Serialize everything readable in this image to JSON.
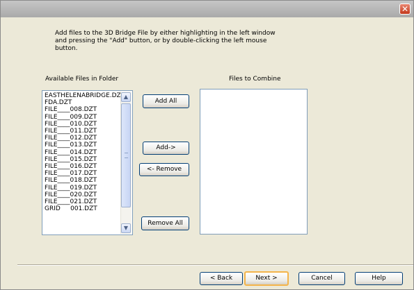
{
  "window": {
    "title": "",
    "close_glyph": "✕"
  },
  "instructions": "Add files to the 3D Bridge File by either highlighting in the left window and pressing the \"Add\" button, or by double-clicking the left mouse button.",
  "available": {
    "label": "Available Files in Folder",
    "files": [
      "EASTHELENABRIDGE.DZT",
      "FDA.DZT",
      "FILE____008.DZT",
      "FILE____009.DZT",
      "FILE____010.DZT",
      "FILE____011.DZT",
      "FILE____012.DZT",
      "FILE____013.DZT",
      "FILE____014.DZT",
      "FILE____015.DZT",
      "FILE____016.DZT",
      "FILE____017.DZT",
      "FILE____018.DZT",
      "FILE____019.DZT",
      "FILE____020.DZT",
      "FILE____021.DZT",
      "GRID     001.DZT"
    ],
    "scroll_up": "▲",
    "scroll_down": "▼"
  },
  "combine": {
    "label": "Files to Combine",
    "files": []
  },
  "actions": {
    "add_all": "Add All",
    "add": "Add->",
    "remove": "<- Remove",
    "remove_all": "Remove All"
  },
  "footer": {
    "back": "< Back",
    "next": "Next >",
    "cancel": "Cancel",
    "help": "Help"
  }
}
